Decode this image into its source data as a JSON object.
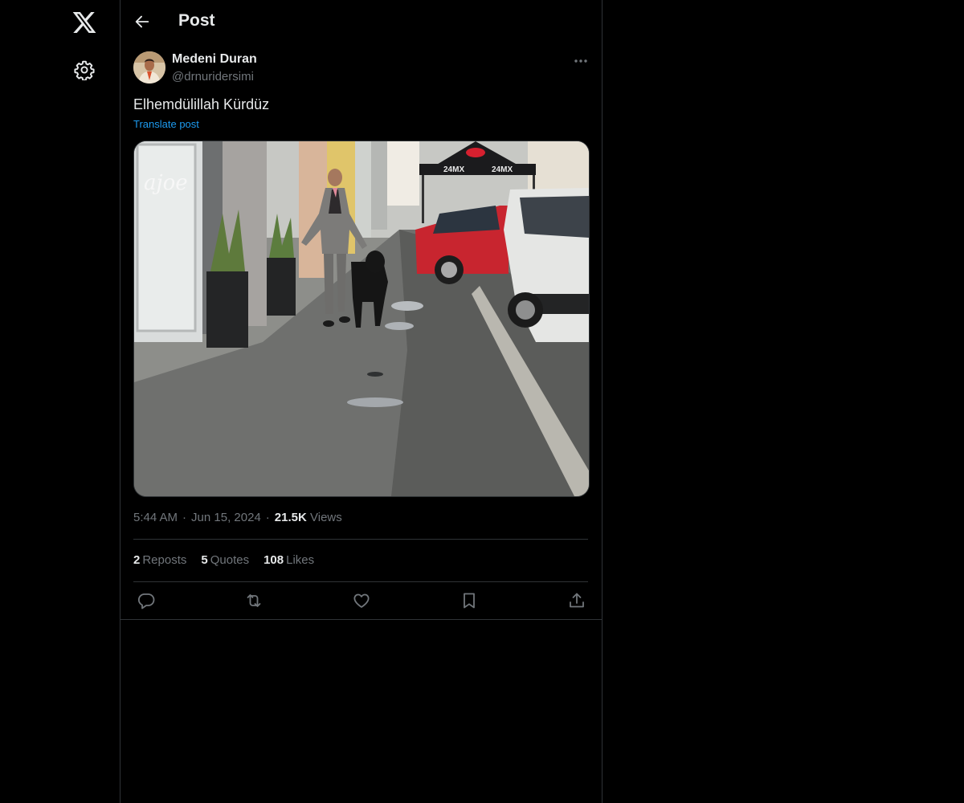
{
  "header": {
    "title": "Post"
  },
  "post": {
    "author_name": "Medeni Duran",
    "author_handle": "@drnuridersimi",
    "text": "Elhemdülillah Kürdüz",
    "translate_label": "Translate post",
    "time": "5:44 AM",
    "date": "Jun 15, 2024",
    "views_count": "21.5K",
    "views_label": "Views",
    "separator": "·",
    "media": {
      "tent_brand": "24MX",
      "shop_sign_left": "ajoe"
    }
  },
  "stats": {
    "reposts_count": "2",
    "reposts_label": "Reposts",
    "quotes_count": "5",
    "quotes_label": "Quotes",
    "likes_count": "108",
    "likes_label": "Likes"
  },
  "icons": {
    "logo": "x-logo-icon",
    "settings": "gear-icon",
    "back": "arrow-left-icon",
    "more": "more-horizontal-icon",
    "reply": "reply-icon",
    "repost": "repost-icon",
    "like": "heart-icon",
    "bookmark": "bookmark-icon",
    "share": "share-icon"
  },
  "colors": {
    "background": "#000000",
    "border": "#2f3336",
    "text_primary": "#e7e9ea",
    "text_secondary": "#71767b",
    "accent": "#1d9bf0"
  }
}
